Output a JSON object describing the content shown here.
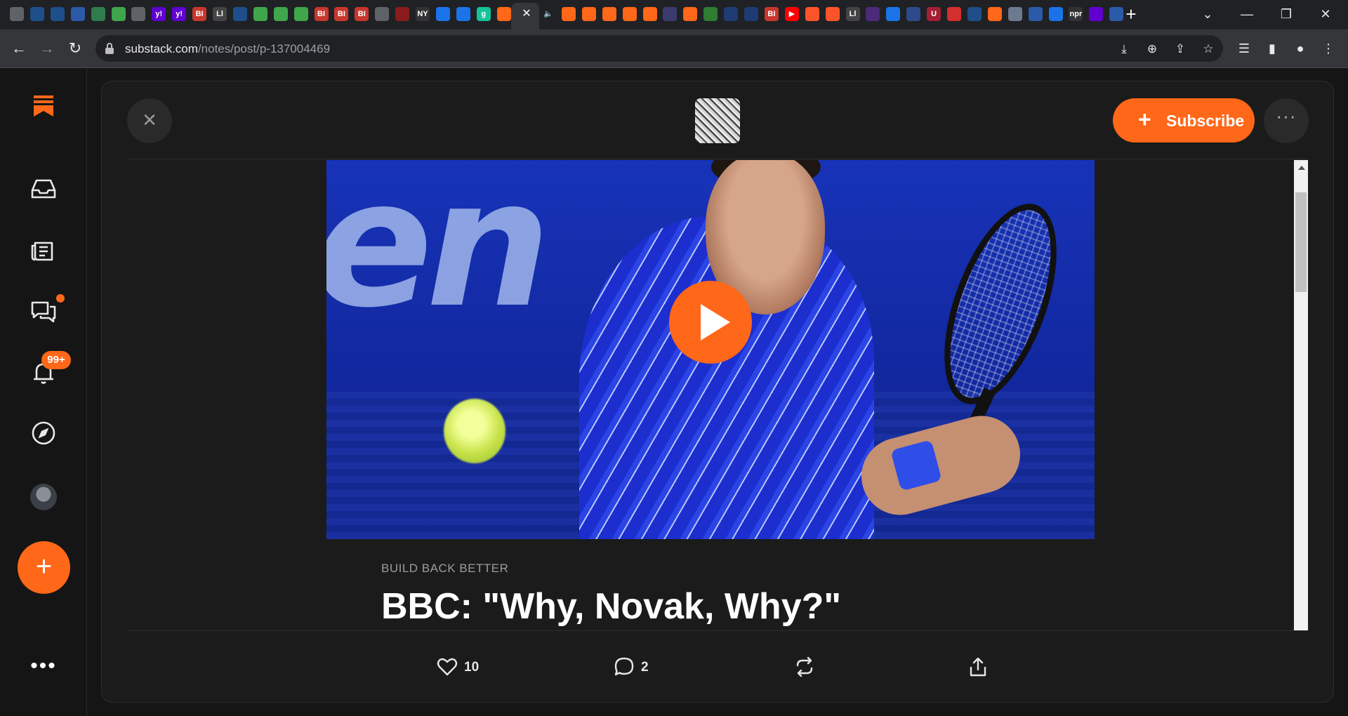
{
  "browser": {
    "tabs": [
      {
        "icon": "globe-icon",
        "color": "#5f6368",
        "text": ""
      },
      {
        "icon": "shield-tab-icon",
        "color": "#1e4f8a",
        "text": ""
      },
      {
        "icon": "shield-tab-icon",
        "color": "#1e4f8a",
        "text": ""
      },
      {
        "icon": "document-tab-icon",
        "color": "#2b5aa8",
        "text": ""
      },
      {
        "icon": "map-tab-icon",
        "color": "#2f7d4e",
        "text": ""
      },
      {
        "icon": "play-tab-icon",
        "color": "#3fa64b",
        "text": ""
      },
      {
        "icon": "globe-icon",
        "color": "#5f6368",
        "text": ""
      },
      {
        "icon": "yahoo-icon",
        "color": "#6001d2",
        "text": "y!"
      },
      {
        "icon": "yahoo-icon",
        "color": "#6001d2",
        "text": "y!"
      },
      {
        "icon": "bi-icon",
        "color": "#c8372d",
        "text": "BI"
      },
      {
        "icon": "script-tab-icon",
        "color": "#444444",
        "text": "Ll"
      },
      {
        "icon": "shield-tab-icon",
        "color": "#1e4f8a",
        "text": ""
      },
      {
        "icon": "play-tab-icon",
        "color": "#3fa64b",
        "text": ""
      },
      {
        "icon": "play-tab-icon",
        "color": "#3fa64b",
        "text": ""
      },
      {
        "icon": "play-tab-icon",
        "color": "#3fa64b",
        "text": ""
      },
      {
        "icon": "bi-icon",
        "color": "#c8372d",
        "text": "BI"
      },
      {
        "icon": "bi-icon",
        "color": "#c8372d",
        "text": "BI"
      },
      {
        "icon": "bi-icon",
        "color": "#c8372d",
        "text": "BI"
      },
      {
        "icon": "globe-icon",
        "color": "#5f6368",
        "text": ""
      },
      {
        "icon": "burst-tab-icon",
        "color": "#8a1c1c",
        "text": ""
      },
      {
        "icon": "news-tab-icon",
        "color": "#333333",
        "text": "NY"
      },
      {
        "icon": "search-tab-icon",
        "color": "#1a73e8",
        "text": ""
      },
      {
        "icon": "search-tab-icon",
        "color": "#1a73e8",
        "text": ""
      },
      {
        "icon": "grammarly-icon",
        "color": "#15c39a",
        "text": "g"
      },
      {
        "icon": "substack-tab-icon",
        "color": "#ff6719",
        "text": ""
      }
    ],
    "tabs_right": [
      {
        "icon": "audio-icon",
        "color": "#202124",
        "text": "🔈"
      },
      {
        "icon": "substack-tab-icon",
        "color": "#ff6719",
        "text": ""
      },
      {
        "icon": "substack-tab-icon",
        "color": "#ff6719",
        "text": ""
      },
      {
        "icon": "substack-tab-icon",
        "color": "#ff6719",
        "text": ""
      },
      {
        "icon": "substack-tab-icon",
        "color": "#ff6719",
        "text": ""
      },
      {
        "icon": "substack-tab-icon",
        "color": "#ff6719",
        "text": ""
      },
      {
        "icon": "flag-tab-icon",
        "color": "#3c3b6e",
        "text": ""
      },
      {
        "icon": "substack-tab-icon",
        "color": "#ff6719",
        "text": ""
      },
      {
        "icon": "seal-tab-icon",
        "color": "#2e7d32",
        "text": ""
      },
      {
        "icon": "hex-tab-icon",
        "color": "#1f3b73",
        "text": ""
      },
      {
        "icon": "hex-tab-icon",
        "color": "#1f3b73",
        "text": ""
      },
      {
        "icon": "bi-icon",
        "color": "#c8372d",
        "text": "BI"
      },
      {
        "icon": "youtube-icon",
        "color": "#ff0000",
        "text": "▶"
      },
      {
        "icon": "brave-tab-icon",
        "color": "#fb542b",
        "text": ""
      },
      {
        "icon": "brave-tab-icon",
        "color": "#fb542b",
        "text": ""
      },
      {
        "icon": "script-tab-icon",
        "color": "#444444",
        "text": "Ll"
      },
      {
        "icon": "purple-tab-icon",
        "color": "#4b2a7a",
        "text": ""
      },
      {
        "icon": "search-tab-icon",
        "color": "#1a73e8",
        "text": ""
      },
      {
        "icon": "crest-tab-icon",
        "color": "#2d4a8a",
        "text": ""
      },
      {
        "icon": "book-tab-icon",
        "color": "#a31f34",
        "text": "U"
      },
      {
        "icon": "mic-tab-icon",
        "color": "#d32f2f",
        "text": ""
      },
      {
        "icon": "shield-tab-icon",
        "color": "#1e4f8a",
        "text": ""
      },
      {
        "icon": "substack-tab-icon",
        "color": "#ff6719",
        "text": ""
      },
      {
        "icon": "portrait-tab-icon",
        "color": "#6b7a8f",
        "text": ""
      },
      {
        "icon": "document-tab-icon",
        "color": "#2b5aa8",
        "text": ""
      },
      {
        "icon": "search-tab-icon",
        "color": "#1a73e8",
        "text": ""
      },
      {
        "icon": "npr-tab-icon",
        "color": "#333333",
        "text": "npr"
      },
      {
        "icon": "yahoo-icon",
        "color": "#6001d2",
        "text": ""
      },
      {
        "icon": "document-tab-icon",
        "color": "#2b5aa8",
        "text": ""
      }
    ],
    "url_host": "substack.com",
    "url_path": "/notes/post/p-137004469"
  },
  "substack": {
    "notifications_badge": "99+",
    "subscribe_label": "Subscribe",
    "post": {
      "kicker": "BUILD BACK BETTER",
      "title": "BBC: \"Why, Novak, Why?\"",
      "video_text": "en"
    },
    "actions": {
      "likes": "10",
      "comments": "2"
    }
  },
  "colors": {
    "accent": "#ff6719",
    "background": "#151515",
    "card": "#1b1b1b"
  }
}
